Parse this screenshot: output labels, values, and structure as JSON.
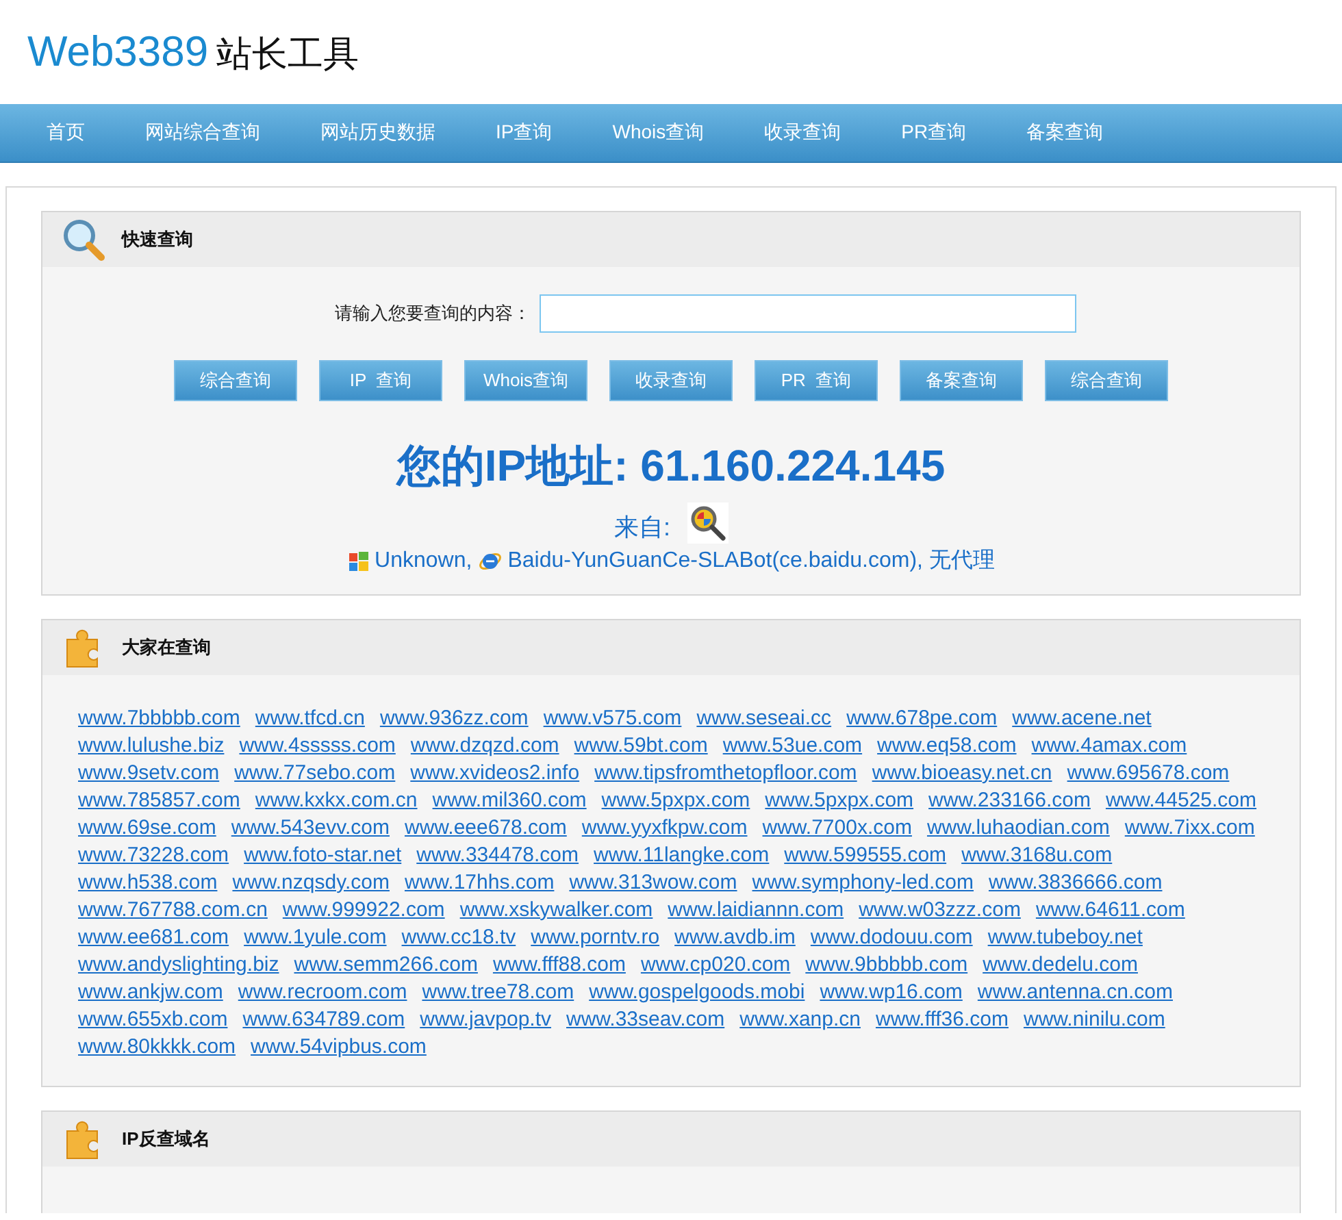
{
  "logo": {
    "brand": "Web3389",
    "suffix": "站长工具"
  },
  "nav": [
    "首页",
    "网站综合查询",
    "网站历史数据",
    "IP查询",
    "Whois查询",
    "收录查询",
    "PR查询",
    "备案查询"
  ],
  "quick_query": {
    "title": "快速查询",
    "prompt": "请输入您要查询的内容：",
    "buttons": [
      "综合查询",
      "IP  查询",
      "Whois查询",
      "收录查询",
      "PR  查询",
      "备案查询",
      "综合查询"
    ],
    "ip_line": "您的IP地址: 61.160.224.145",
    "from_label": "来自:",
    "os": "Unknown,",
    "browser": "Baidu-YunGuanCe-SLABot(ce.baidu.com), 无代理"
  },
  "popular": {
    "title": "大家在查询",
    "links": [
      "www.7bbbbb.com",
      "www.tfcd.cn",
      "www.936zz.com",
      "www.v575.com",
      "www.seseai.cc",
      "www.678pe.com",
      "www.acene.net",
      "www.lulushe.biz",
      "www.4sssss.com",
      "www.dzqzd.com",
      "www.59bt.com",
      "www.53ue.com",
      "www.eq58.com",
      "www.4amax.com",
      "www.9setv.com",
      "www.77sebo.com",
      "www.xvideos2.info",
      "www.tipsfromthetopfloor.com",
      "www.bioeasy.net.cn",
      "www.695678.com",
      "www.785857.com",
      "www.kxkx.com.cn",
      "www.mil360.com",
      "www.5pxpx.com",
      "www.5pxpx.com",
      "www.233166.com",
      "www.44525.com",
      "www.69se.com",
      "www.543evv.com",
      "www.eee678.com",
      "www.yyxfkpw.com",
      "www.7700x.com",
      "www.luhaodian.com",
      "www.7ixx.com",
      "www.73228.com",
      "www.foto-star.net",
      "www.334478.com",
      "www.11langke.com",
      "www.599555.com",
      "www.3168u.com",
      "www.h538.com",
      "www.nzqsdy.com",
      "www.17hhs.com",
      "www.313wow.com",
      "www.symphony-led.com",
      "www.3836666.com",
      "www.767788.com.cn",
      "www.999922.com",
      "www.xskywalker.com",
      "www.laidiannn.com",
      "www.w03zzz.com",
      "www.64611.com",
      "www.ee681.com",
      "www.1yule.com",
      "www.cc18.tv",
      "www.porntv.ro",
      "www.avdb.im",
      "www.dodouu.com",
      "www.tubeboy.net",
      "www.andyslighting.biz",
      "www.semm266.com",
      "www.fff88.com",
      "www.cp020.com",
      "www.9bbbbb.com",
      "www.dedelu.com",
      "www.ankjw.com",
      "www.recroom.com",
      "www.tree78.com",
      "www.gospelgoods.mobi",
      "www.wp16.com",
      "www.antenna.cn.com",
      "www.655xb.com",
      "www.634789.com",
      "www.javpop.tv",
      "www.33seav.com",
      "www.xanp.cn",
      "www.fff36.com",
      "www.ninilu.com",
      "www.80kkkk.com",
      "www.54vipbus.com"
    ]
  },
  "reverse_ip": {
    "title": "IP反查域名"
  }
}
